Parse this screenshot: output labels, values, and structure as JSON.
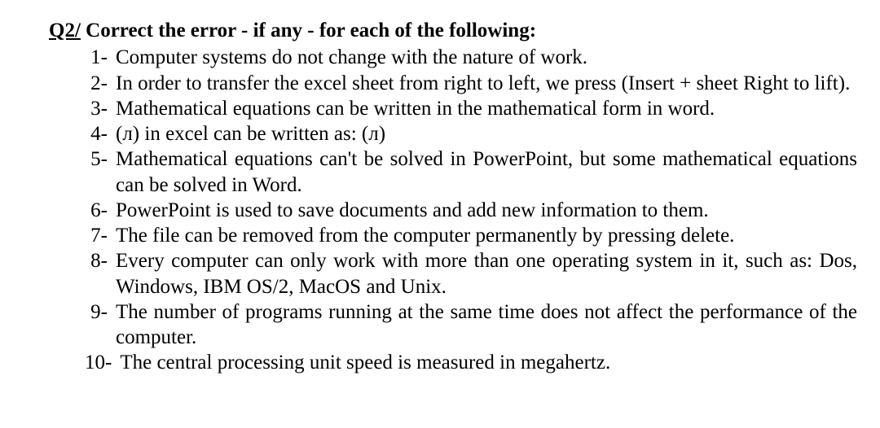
{
  "heading": {
    "qnum": "Q2/",
    "title": " Correct the error - if any - for each of the following:"
  },
  "items": [
    {
      "n": "1-",
      "text": "Computer systems do not change with the nature of work.",
      "justify": false
    },
    {
      "n": "2-",
      "text": "In order to transfer the excel sheet from right to left, we press (Insert + sheet Right to lift).",
      "justify": true
    },
    {
      "n": "3-",
      "text": "Mathematical equations can be written in the mathematical form in word.",
      "justify": false
    },
    {
      "n": "4-",
      "text": "(л) in excel can be written as: (л)",
      "justify": false
    },
    {
      "n": "5-",
      "text": "Mathematical equations can't be solved in PowerPoint, but some mathematical equations can be solved in Word.",
      "justify": true
    },
    {
      "n": "6-",
      "text": "PowerPoint is used to save documents and add new information to them.",
      "justify": false
    },
    {
      "n": "7-",
      "text": "The file can be removed from the computer permanently by pressing delete.",
      "justify": false
    },
    {
      "n": "8-",
      "text": "Every computer can only work with more than one operating system in it, such as: Dos, Windows, IBM OS/2, MacOS and Unix.",
      "justify": true
    },
    {
      "n": "9-",
      "text": "The number of programs running at the same time does not affect the performance of the computer.",
      "justify": true
    },
    {
      "n": "10-",
      "text": "The central processing unit speed is measured in megahertz.",
      "justify": false
    }
  ]
}
